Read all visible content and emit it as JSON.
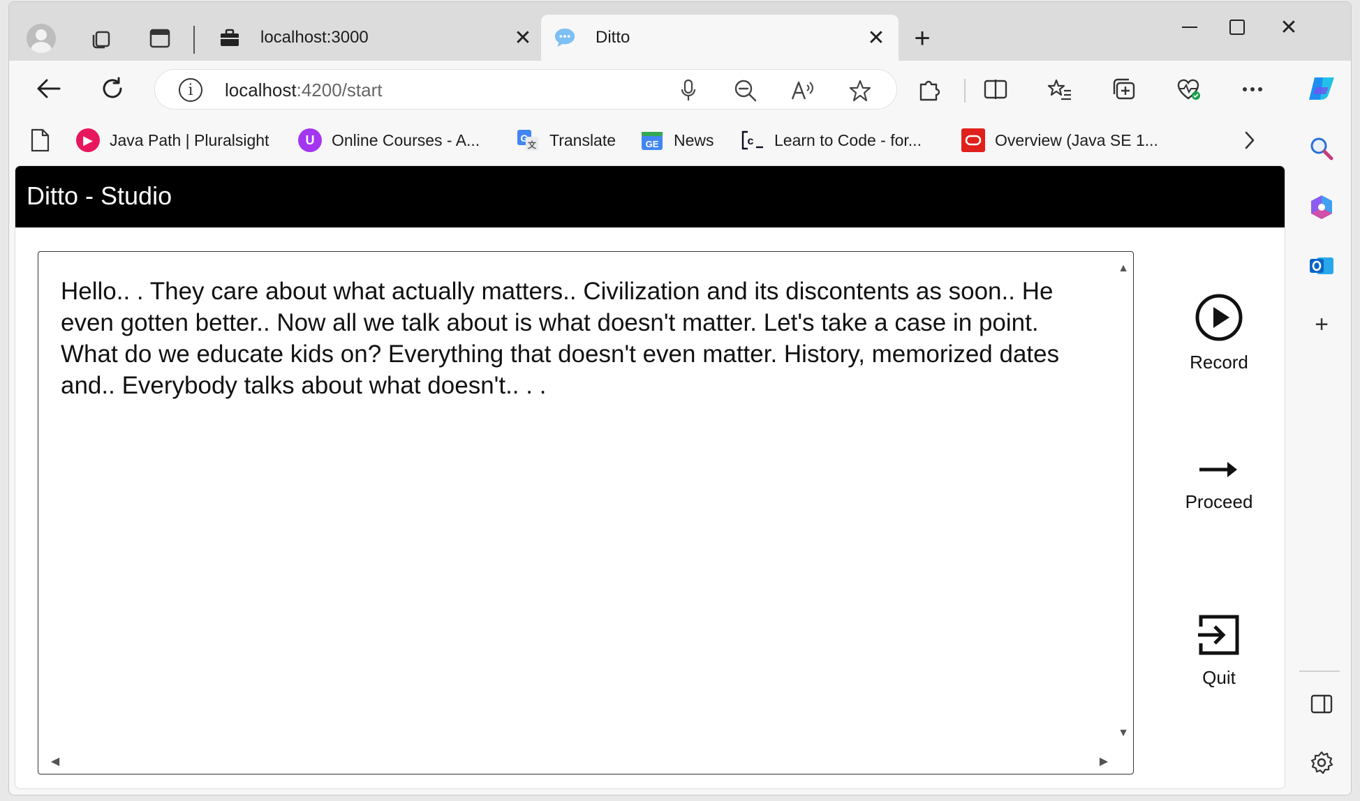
{
  "browser": {
    "tabs": [
      {
        "title": "localhost:3000",
        "active": false
      },
      {
        "title": "Ditto",
        "active": true
      }
    ],
    "address": {
      "host": "localhost",
      "path": ":4200/start"
    },
    "bookmarks": [
      {
        "label": "Java Path | Pluralsight",
        "icon": "pluralsight-icon"
      },
      {
        "label": "Online Courses - A...",
        "icon": "udemy-icon"
      },
      {
        "label": "Translate",
        "icon": "translate-icon"
      },
      {
        "label": "News",
        "icon": "news-icon"
      },
      {
        "label": "Learn to Code - for...",
        "icon": "freecodecamp-icon"
      },
      {
        "label": "Overview (Java SE 1...",
        "icon": "oracle-icon"
      }
    ]
  },
  "app": {
    "title": "Ditto - Studio",
    "transcript": "Hello.. . They care about what actually matters.. Civilization and its discontents as soon.. He even gotten better.. Now all we talk about is what doesn't matter. Let's take a case in point. What do we educate kids on? Everything that doesn't even matter. History, memorized dates and.. Everybody talks about what doesn't.. . .",
    "actions": {
      "record": "Record",
      "proceed": "Proceed",
      "quit": "Quit"
    }
  },
  "colors": {
    "appbar": "#000000",
    "pluralsight": "#e8175d",
    "udemy": "#a435f0",
    "oracle": "#e0201b",
    "copilot": "#1f8ef1"
  }
}
